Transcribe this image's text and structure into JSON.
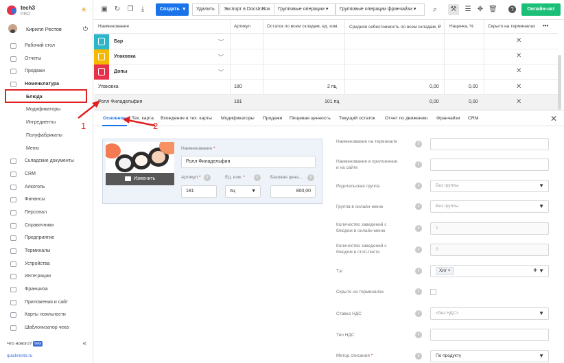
{
  "app": {
    "name": "tech3",
    "plan": "PRO"
  },
  "user": {
    "name": "Кирилл Рестов"
  },
  "sidebar": {
    "items": [
      {
        "label": "Рабочий стол",
        "icon": "desktop-icon"
      },
      {
        "label": "Отчеты",
        "icon": "reports-icon"
      },
      {
        "label": "Продажи",
        "icon": "sales-icon"
      },
      {
        "label": "Номенклатура",
        "icon": "nomenclature-icon"
      },
      {
        "label": "Блюда"
      },
      {
        "label": "Модификаторы"
      },
      {
        "label": "Ингредиенты"
      },
      {
        "label": "Полуфабрикаты"
      },
      {
        "label": "Меню"
      },
      {
        "label": "Складские документы",
        "icon": "warehouse-icon"
      },
      {
        "label": "CRM",
        "icon": "crm-icon"
      },
      {
        "label": "Алкоголь",
        "icon": "alcohol-icon"
      },
      {
        "label": "Финансы",
        "icon": "finance-icon"
      },
      {
        "label": "Персонал",
        "icon": "staff-icon"
      },
      {
        "label": "Справочники",
        "icon": "directories-icon"
      },
      {
        "label": "Предприятие",
        "icon": "enterprise-icon"
      },
      {
        "label": "Терминалы",
        "icon": "terminals-icon"
      },
      {
        "label": "Устройства",
        "icon": "devices-icon"
      },
      {
        "label": "Интеграции",
        "icon": "integrations-icon"
      },
      {
        "label": "Франшиза",
        "icon": "franchise-icon"
      },
      {
        "label": "Приложения и сайт",
        "icon": "apps-icon"
      },
      {
        "label": "Карты лояльности",
        "icon": "loyalty-icon"
      },
      {
        "label": "Шаблонизатор чека",
        "icon": "receipt-icon"
      }
    ],
    "whats_new": "Что нового?",
    "beta": "beta",
    "site": "quickresto.ru"
  },
  "toolbar": {
    "create": "Создать",
    "delete": "Удалить",
    "export": "Экспорт в DocsInBox",
    "group_ops": "Групповые операции",
    "group_ops_franchise": "Групповые операции франчайзи",
    "chat": "Онлайн-чат"
  },
  "grid": {
    "columns": [
      "Наименование",
      "Артикул",
      "Остаток по всем складам, ед. изм.",
      "Средняя себестоимость по всем складам, ₽",
      "Наценка, %",
      "Скрыто на терминалах"
    ],
    "more": "•••",
    "rows": [
      {
        "name": "Бар",
        "type": "category",
        "color": "#2bb6c9"
      },
      {
        "name": "Упаковка",
        "type": "category",
        "color": "#f5b800"
      },
      {
        "name": "Допы",
        "type": "category",
        "color": "#e8304a"
      },
      {
        "name": "Упаковка",
        "article": "180",
        "stock": "2 пц",
        "cost": "0,00",
        "markup": "0,00"
      },
      {
        "name": "Ролл Филадельфия",
        "article": "181",
        "stock": "101 пц",
        "cost": "0,00",
        "markup": "0,00"
      }
    ]
  },
  "tabs": [
    "Основное",
    "Тех. карта",
    "Вхождение в тех. карты",
    "Модификаторы",
    "Продажи",
    "Пищевая ценность",
    "Текущий остаток",
    "Отчет по движению",
    "Франчайзи",
    "CRM"
  ],
  "card": {
    "photo_button": "Изменить",
    "name_label": "Наименование",
    "name_value": "Ролл Филадельфия",
    "article_label": "Артикул",
    "article_value": "181",
    "unit_label": "Ед. изм.",
    "unit_value": "пц",
    "price_label": "Базовая цена...",
    "price_value": "800,00"
  },
  "form": {
    "terminal_name": "Наименование на терминале",
    "app_name": "Наименование в приложении и на сайте",
    "parent_group": "Родительская группа",
    "parent_group_value": "Без группы",
    "online_group": "Группа в онлайн-меню",
    "online_group_value": "Без группы",
    "online_count": "Количество заведений с блюдом в онлайн-меню",
    "online_count_value": "1",
    "stop_count": "Количество заведений с блюдом в стоп-листе",
    "stop_count_value": "0",
    "tag": "Тэг",
    "tag_value": "Хит",
    "hidden": "Скрыто на терминалах",
    "vat_rate": "Ставка НДС",
    "vat_rate_value": "<без НДС>",
    "vat_type": "Тип НДС",
    "writeoff": "Метод списания",
    "writeoff_value": "По продукту"
  },
  "annotations": {
    "one": "1",
    "two": "2"
  },
  "colors": {
    "accent": "#1a73e8",
    "chat": "#1cbf78",
    "annotation": "#e02020"
  }
}
